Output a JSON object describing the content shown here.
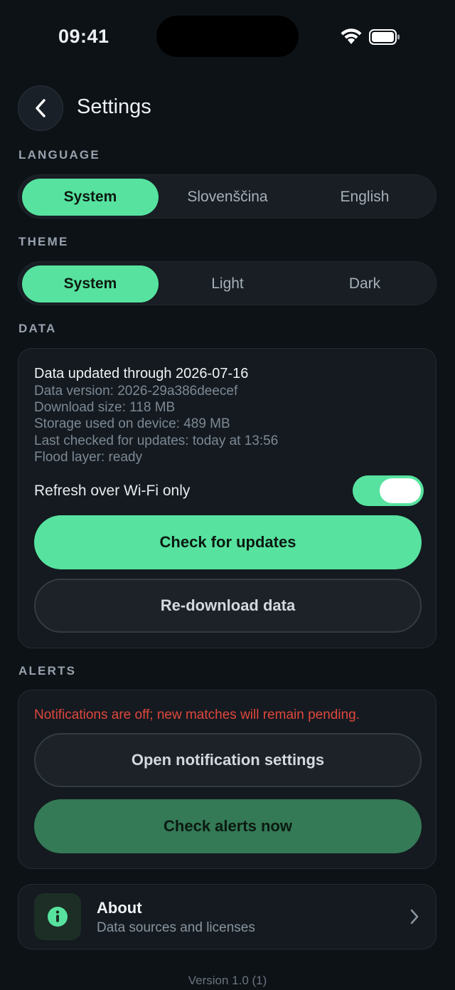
{
  "status": {
    "time": "09:41"
  },
  "header": {
    "title": "Settings"
  },
  "language": {
    "label": "LANGUAGE",
    "options": [
      "System",
      "Slovenščina",
      "English"
    ],
    "selected": "System"
  },
  "theme": {
    "label": "THEME",
    "options": [
      "System",
      "Light",
      "Dark"
    ],
    "selected": "System"
  },
  "data": {
    "label": "DATA",
    "updated": "Data updated through 2026-07-16",
    "version": "Data version: 2026-29a386deecef",
    "download_size": "Download size: 118 MB",
    "storage": "Storage used on device: 489 MB",
    "last_checked": "Last checked for updates: today at 13:56",
    "flood_layer": "Flood layer: ready",
    "wifi_only_label": "Refresh over Wi‑Fi only",
    "wifi_only_on": true,
    "check_updates_label": "Check for updates",
    "redownload_label": "Re-download data"
  },
  "alerts": {
    "label": "ALERTS",
    "warning": "Notifications are off; new matches will remain pending.",
    "open_settings_label": "Open notification settings",
    "check_now_label": "Check alerts now"
  },
  "about": {
    "title": "About",
    "subtitle": "Data sources and licenses"
  },
  "footer": {
    "version": "Version 1.0 (1)"
  },
  "colors": {
    "accent": "#57e39f",
    "background": "#0d1217",
    "card": "#141a20",
    "warning": "#e0473c"
  }
}
